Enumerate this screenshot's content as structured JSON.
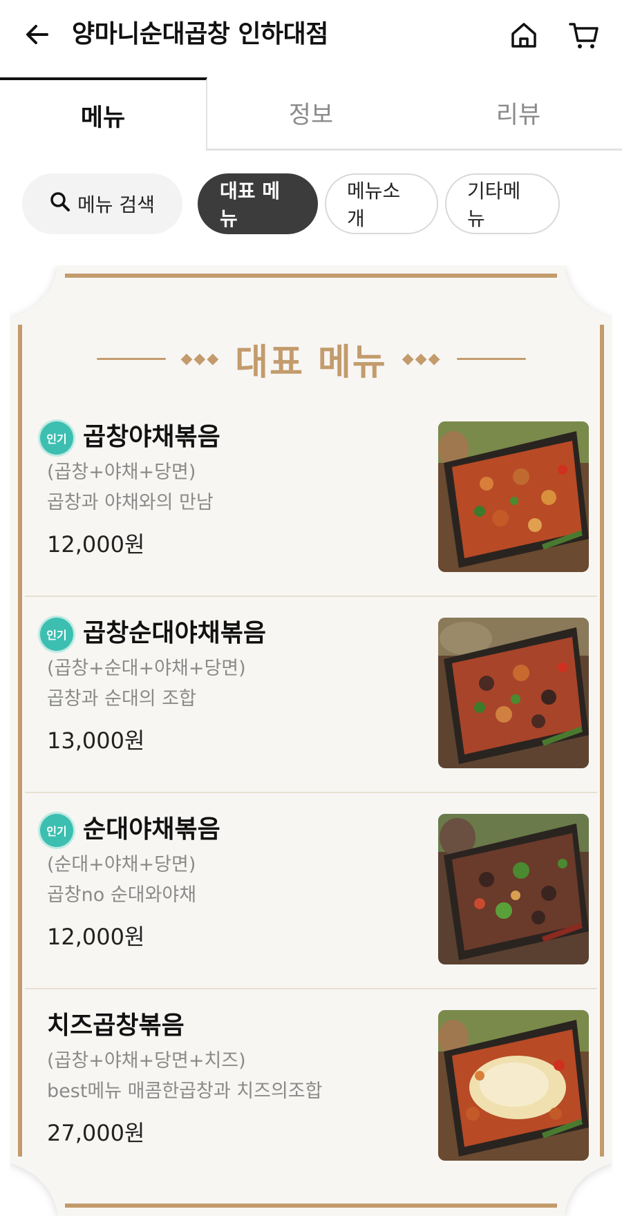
{
  "header": {
    "title": "양마니순대곱창 인하대점",
    "back_icon": "arrow-left-icon",
    "home_icon": "home-icon",
    "cart_icon": "cart-icon"
  },
  "tabs": [
    {
      "label": "메뉴",
      "active": true
    },
    {
      "label": "정보",
      "active": false
    },
    {
      "label": "리뷰",
      "active": false
    }
  ],
  "chips": {
    "search": "메뉴 검색",
    "items": [
      "대표 메뉴",
      "메뉴소개",
      "기타메뉴"
    ],
    "selected": "대표 메뉴"
  },
  "section": {
    "title": "대표 메뉴",
    "accent_color": "#c39b6c"
  },
  "menu": [
    {
      "badge": "인기",
      "name": "곱창야채볶음",
      "desc1": "(곱창+야채+당면)",
      "desc2": "곱창과 야채와의 만남",
      "price": "12,000원"
    },
    {
      "badge": "인기",
      "name": "곱창순대야채볶음",
      "desc1": "(곱창+순대+야채+당면)",
      "desc2": "곱창과 순대의 조합",
      "price": "13,000원"
    },
    {
      "badge": "인기",
      "name": "순대야채볶음",
      "desc1": "(순대+야채+당면)",
      "desc2": "곱창no 순대와야채",
      "price": "12,000원"
    },
    {
      "badge": "",
      "name": "치즈곱창볶음",
      "desc1": "(곱창+야채+당면+치즈)",
      "desc2": "best메뉴 매콤한곱창과 치즈의조합",
      "price": "27,000원"
    }
  ]
}
